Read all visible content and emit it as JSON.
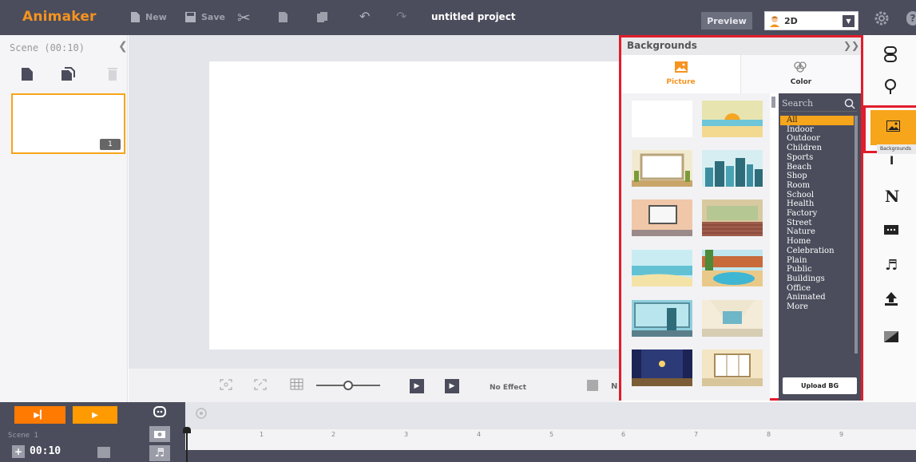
{
  "app": {
    "logo": "Animaker",
    "project_title": "untitled project"
  },
  "toolbar": {
    "new_label": "New",
    "save_label": "Save",
    "preview_label": "Preview",
    "mode_value": "2D"
  },
  "scene_panel": {
    "header": "Scene (00:10)",
    "thumb_number": "1"
  },
  "stage": {
    "effect_label": "No Effect",
    "truncated_label": "N"
  },
  "backgrounds": {
    "title": "Backgrounds",
    "tabs": [
      {
        "label": "Picture",
        "active": true
      },
      {
        "label": "Color",
        "active": false
      }
    ],
    "search_placeholder": "Search",
    "categories": [
      "All",
      "Indoor",
      "Outdoor",
      "Children",
      "Sports",
      "Beach",
      "Shop",
      "Room",
      "School",
      "Health",
      "Factory",
      "Street",
      "Nature",
      "Home",
      "Celebration",
      "Plain",
      "Public",
      "Buildings",
      "Office",
      "Animated",
      "More"
    ],
    "active_category": "All",
    "upload_label": "Upload BG",
    "thumbnails": [
      {
        "name": "blank",
        "icon": "blank-bg"
      },
      {
        "name": "beach-sunset",
        "icon": "beach-scene"
      },
      {
        "name": "classroom-board",
        "icon": "board-scene"
      },
      {
        "name": "city-skyline",
        "icon": "city-scene"
      },
      {
        "name": "room-tv",
        "icon": "room-scene"
      },
      {
        "name": "auditorium",
        "icon": "hall-scene"
      },
      {
        "name": "seaside",
        "icon": "sea-scene"
      },
      {
        "name": "pool",
        "icon": "pool-scene"
      },
      {
        "name": "office-window",
        "icon": "office-scene"
      },
      {
        "name": "airport",
        "icon": "airport-scene"
      },
      {
        "name": "stage-night",
        "icon": "stage-scene"
      },
      {
        "name": "shop-front",
        "icon": "shop-scene"
      }
    ]
  },
  "sidebar": {
    "tooltip": "Backgrounds",
    "icons": [
      "character-icon",
      "pin-icon",
      "background-icon",
      "text-icon",
      "numbers-icon",
      "text-box-icon",
      "music-icon",
      "upload-icon",
      "effects-icon"
    ]
  },
  "timeline": {
    "scene_label": "Scene 1",
    "duration": "00:10",
    "ticks": [
      "1",
      "2",
      "3",
      "4",
      "5",
      "6",
      "7",
      "8",
      "9"
    ]
  },
  "colors": {
    "accent": "#f7a51a",
    "highlight": "#e21c2c",
    "chrome": "#4b4d5c"
  }
}
